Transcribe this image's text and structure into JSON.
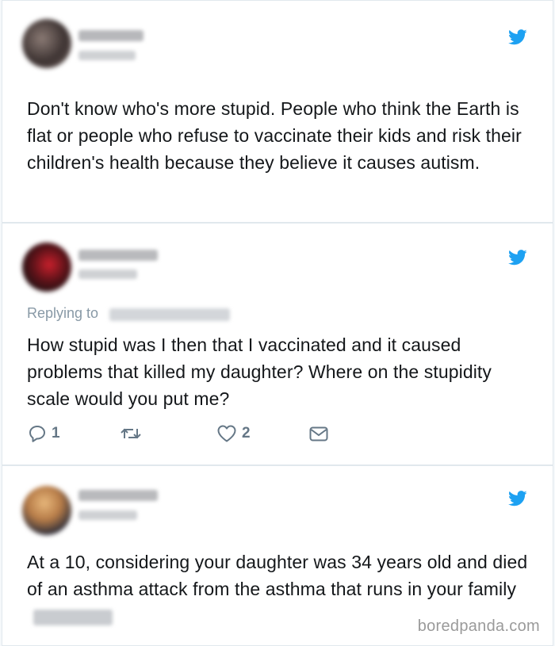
{
  "tweets": [
    {
      "text": "Don't know who's more stupid. People who think the Earth is flat or people who refuse to vaccinate their kids and risk their children's health because they believe it causes autism."
    },
    {
      "replying_label": "Replying to",
      "text": "How stupid was I then that I vaccinated and it caused problems that killed my daughter? Where on the stupidity scale would you put me?",
      "reply_count": "1",
      "like_count": "2"
    },
    {
      "text": "At a 10, considering your daughter was 34 years old and died of an asthma attack from the asthma that runs in your family"
    }
  ],
  "watermark": "boredpanda.com",
  "icons": {
    "brand": "twitter-bird-icon",
    "reply": "reply-icon",
    "retweet": "retweet-icon",
    "like": "heart-icon",
    "dm": "mail-icon"
  },
  "colors": {
    "twitter_blue": "#1da1f2",
    "muted_text": "#657786",
    "border": "#e1e8ed"
  }
}
